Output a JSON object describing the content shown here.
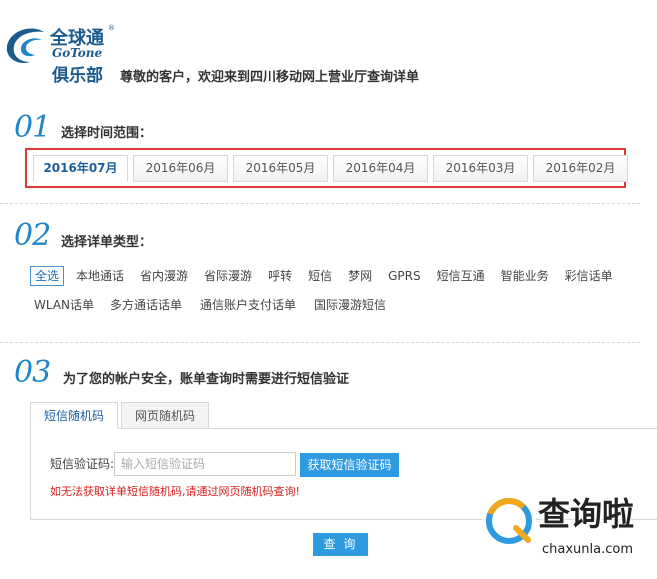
{
  "brand": {
    "logo_cn": "全球通",
    "logo_reg": "®",
    "logo_en": "GoTone",
    "logo_club": "俱乐部",
    "color": "#1b5a8c"
  },
  "header": {
    "welcome": "尊敬的客户，欢迎来到四川移动网上营业厅查询详单"
  },
  "step1": {
    "number": "01",
    "title": "选择时间范围：",
    "months": [
      "2016年07月",
      "2016年06月",
      "2016年05月",
      "2016年04月",
      "2016年03月",
      "2016年02月"
    ],
    "selected": "2016年07月",
    "highlight_color": "#d93a3a"
  },
  "step2": {
    "number": "02",
    "title": "选择详单类型：",
    "types_row1": [
      "全选",
      "本地通话",
      "省内漫游",
      "省际漫游",
      "呼转",
      "短信",
      "梦网",
      "GPRS",
      "短信互通",
      "智能业务",
      "彩信话单"
    ],
    "types_row2": [
      "WLAN话单",
      "多方通话话单",
      "通信账户支付话单",
      "国际漫游短信"
    ],
    "selected": "全选"
  },
  "step3": {
    "number": "03",
    "title": "为了您的帐户安全，账单查询时需要进行短信验证",
    "tabs": [
      "短信随机码",
      "网页随机码"
    ],
    "active_tab": "短信随机码",
    "code_label": "短信验证码:",
    "code_placeholder": "输入短信验证码",
    "code_value": "",
    "get_code_button": "获取短信验证码",
    "warning": "如无法获取详单短信随机码,请通过网页随机码查询!"
  },
  "query_button": "查 询",
  "accent_color": "#2e9ae0",
  "watermark": {
    "text": "查询啦",
    "domain": "chaxunla.com"
  }
}
